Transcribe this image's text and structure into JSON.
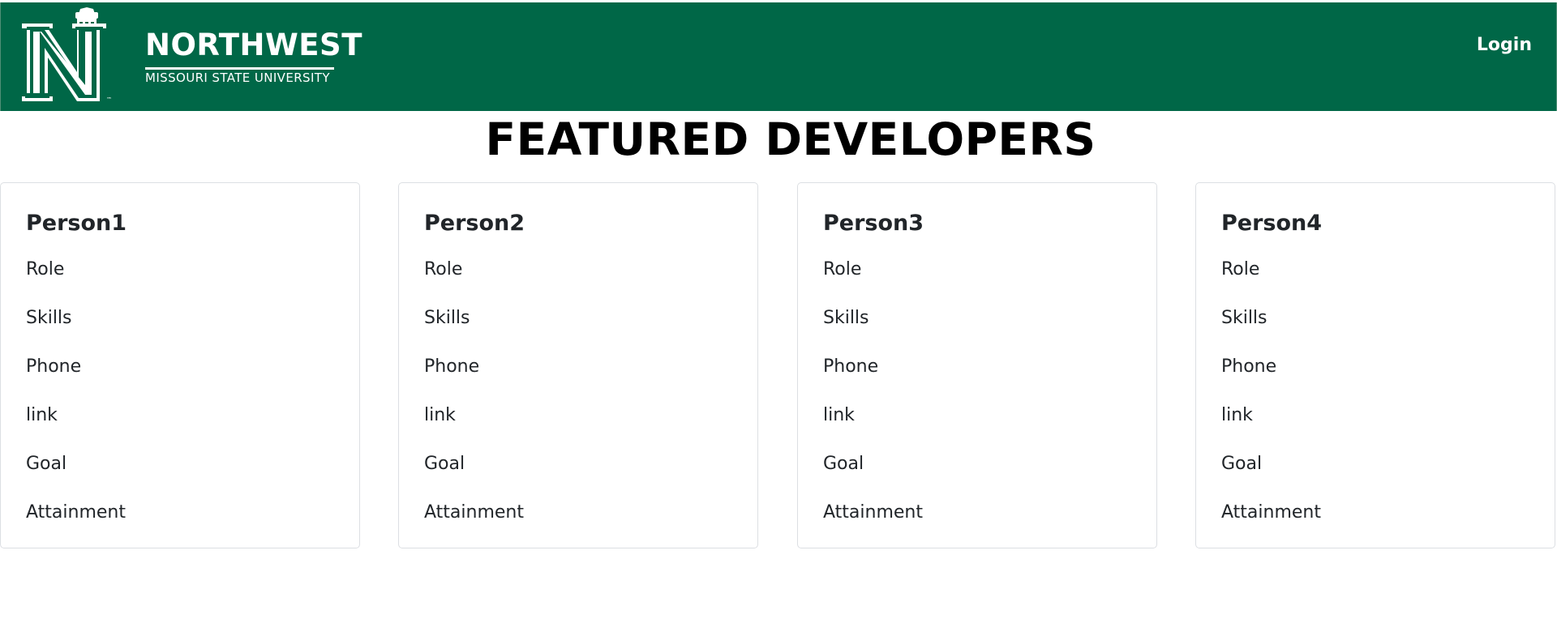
{
  "header": {
    "brand_name": "NORTHWEST",
    "brand_subtitle": "MISSOURI STATE UNIVERSITY",
    "login_label": "Login",
    "colors": {
      "bar": "#006747",
      "text": "#ffffff"
    },
    "logo_icon": "northwest-n-logo-icon"
  },
  "page": {
    "title": "FEATURED DEVELOPERS"
  },
  "developers": [
    {
      "name": "Person1",
      "fields": [
        "Role",
        "Skills",
        "Phone",
        "link",
        "Goal",
        "Attainment"
      ]
    },
    {
      "name": "Person2",
      "fields": [
        "Role",
        "Skills",
        "Phone",
        "link",
        "Goal",
        "Attainment"
      ]
    },
    {
      "name": "Person3",
      "fields": [
        "Role",
        "Skills",
        "Phone",
        "link",
        "Goal",
        "Attainment"
      ]
    },
    {
      "name": "Person4",
      "fields": [
        "Role",
        "Skills",
        "Phone",
        "link",
        "Goal",
        "Attainment"
      ]
    }
  ]
}
